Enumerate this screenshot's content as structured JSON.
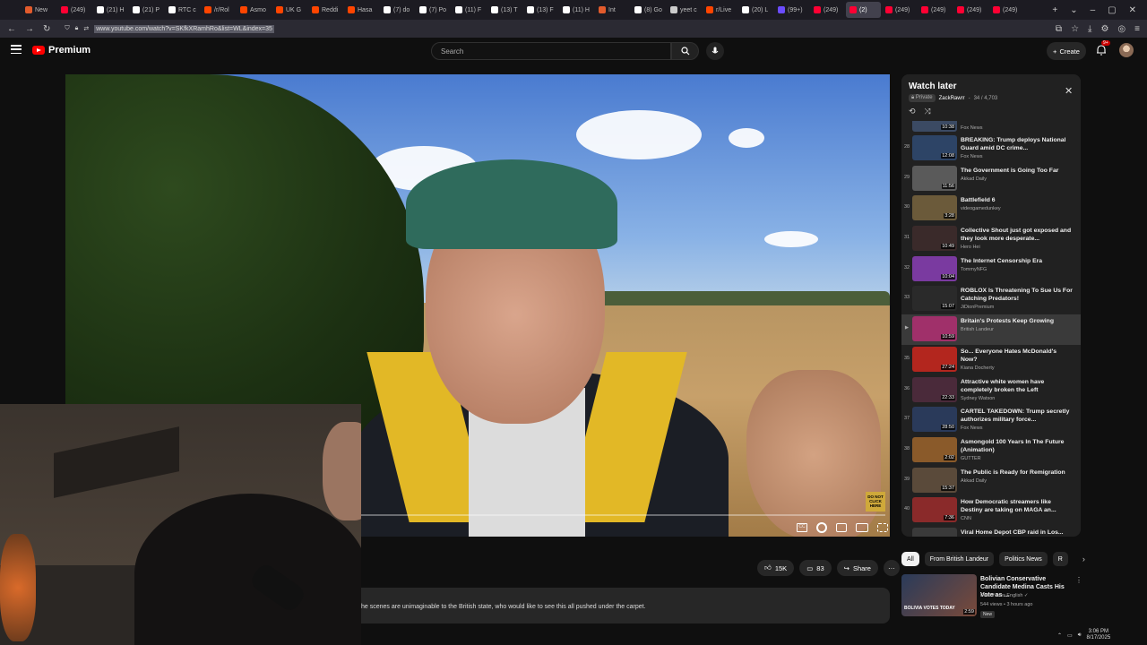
{
  "browser": {
    "tabs": [
      {
        "label": "New",
        "color": "#e25b2c"
      },
      {
        "label": "(249)",
        "color": "#ff0033"
      },
      {
        "label": "(21) H",
        "color": "#ffffff"
      },
      {
        "label": "(21) P",
        "color": "#ffffff"
      },
      {
        "label": "RTC c",
        "color": "#ffffff"
      },
      {
        "label": "/r/Rol",
        "color": "#ff4500"
      },
      {
        "label": "Asmo",
        "color": "#ff4500"
      },
      {
        "label": "UK G",
        "color": "#ff4500"
      },
      {
        "label": "Reddi",
        "color": "#ff4500"
      },
      {
        "label": "Hasa",
        "color": "#ff4500"
      },
      {
        "label": "(7) do",
        "color": "#ffffff"
      },
      {
        "label": "(7) Po",
        "color": "#ffffff"
      },
      {
        "label": "(11) F",
        "color": "#ffffff"
      },
      {
        "label": "(13) T",
        "color": "#ffffff"
      },
      {
        "label": "(13) F",
        "color": "#ffffff"
      },
      {
        "label": "(11) H",
        "color": "#ffffff"
      },
      {
        "label": "Int",
        "color": "#e25b2c"
      },
      {
        "label": "(8) Go",
        "color": "#ffffff"
      },
      {
        "label": "yeet c",
        "color": "#cccccc"
      },
      {
        "label": "r/Live",
        "color": "#ff4500"
      },
      {
        "label": "(20) L",
        "color": "#ffffff"
      },
      {
        "label": "(99+)",
        "color": "#6b4cff"
      },
      {
        "label": "(249)",
        "color": "#ff0033"
      },
      {
        "label": "(2)",
        "color": "#ff0033"
      },
      {
        "label": "(249)",
        "color": "#ff0033"
      },
      {
        "label": "(249)",
        "color": "#ff0033"
      },
      {
        "label": "(249)",
        "color": "#ff0033"
      },
      {
        "label": "(249)",
        "color": "#ff0033"
      }
    ],
    "url": "www.youtube.com/watch?v=SKfkXRamhRo&list=WL&index=35"
  },
  "header": {
    "logo_text": "Premium",
    "search_placeholder": "Search",
    "create_label": "Create",
    "notif_badge": "9+"
  },
  "player": {
    "overlay_badge": "DO NOT CLICK HERE"
  },
  "actions": {
    "likes": "15K",
    "comments": "83",
    "share": "Share",
    "more": "···"
  },
  "description": "he scenes are unimaginable to the British state, who would like to see this all pushed under the carpet.",
  "playlist": {
    "title": "Watch later",
    "privacy": "Private",
    "owner": "ZackRawrr",
    "position": "34 / 4,703",
    "items": [
      {
        "index": "",
        "title": "",
        "channel": "Fox News",
        "duration": "10:38",
        "color": "#3b4a63"
      },
      {
        "index": "28",
        "title": "BREAKING: Trump deploys National Guard amid DC crime...",
        "channel": "Fox News",
        "duration": "12:08",
        "color": "#2d4466"
      },
      {
        "index": "29",
        "title": "The Government is Going Too Far",
        "channel": "Akkad Daily",
        "duration": "11:56",
        "color": "#5a5a5a"
      },
      {
        "index": "30",
        "title": "Battlefield 6",
        "channel": "videogamedunkey",
        "duration": "3:28",
        "color": "#6b5a3a"
      },
      {
        "index": "31",
        "title": "Collective Shout just got exposed and they look more desperate...",
        "channel": "Hero Hei",
        "duration": "10:49",
        "color": "#3a2a2a"
      },
      {
        "index": "32",
        "title": "The Internet Censorship Era",
        "channel": "TommyNFG",
        "duration": "10:04",
        "color": "#7a3aa0"
      },
      {
        "index": "33",
        "title": "ROBLOX Is Threatening To Sue Us For Catching Predators!",
        "channel": "JiDionPremium",
        "duration": "15:07",
        "color": "#2a2a2a"
      },
      {
        "index": "▶",
        "title": "Britain's Protests Keep Growing",
        "channel": "British Landeur",
        "duration": "10:59",
        "color": "#a0306a",
        "current": true
      },
      {
        "index": "35",
        "title": "So... Everyone Hates McDonald's Now?",
        "channel": "Kiana Docherty",
        "duration": "27:24",
        "color": "#b3261e"
      },
      {
        "index": "36",
        "title": "Attractive white women have completely broken the Left",
        "channel": "Sydney Watson",
        "duration": "22:33",
        "color": "#4a2a3a"
      },
      {
        "index": "37",
        "title": "CARTEL TAKEDOWN: Trump secretly authorizes military force...",
        "channel": "Fox News",
        "duration": "28:50",
        "color": "#2a3a5a"
      },
      {
        "index": "38",
        "title": "Asmongold 100 Years In The Future (Animation)",
        "channel": "GUTTER",
        "duration": "2:02",
        "color": "#8a5a2a"
      },
      {
        "index": "39",
        "title": "The Public is Ready for Remigration",
        "channel": "Akkad Daily",
        "duration": "15:37",
        "color": "#5a4a3a"
      },
      {
        "index": "40",
        "title": "How Democratic streamers like Destiny are taking on MAGA an...",
        "channel": "CNN",
        "duration": "7:36",
        "color": "#8a2a2a"
      },
      {
        "index": "41",
        "title": "Viral Home Depot CBP raid in Los...",
        "channel": "",
        "duration": "",
        "color": "#3a3a3a"
      }
    ]
  },
  "chips": [
    "All",
    "From British Landeur",
    "Politics News",
    "R"
  ],
  "recommendation": {
    "title": "Bolivian Conservative Candidate Medina Casts His Vote as ...",
    "channel": "DawnNews English",
    "meta": "544 views • 3 hours ago",
    "badge": "New",
    "duration": "2:59",
    "thumb_text": "BOLIVIA VOTES TODAY"
  },
  "tray": {
    "time": "3:06 PM",
    "date": "8/17/2025"
  }
}
